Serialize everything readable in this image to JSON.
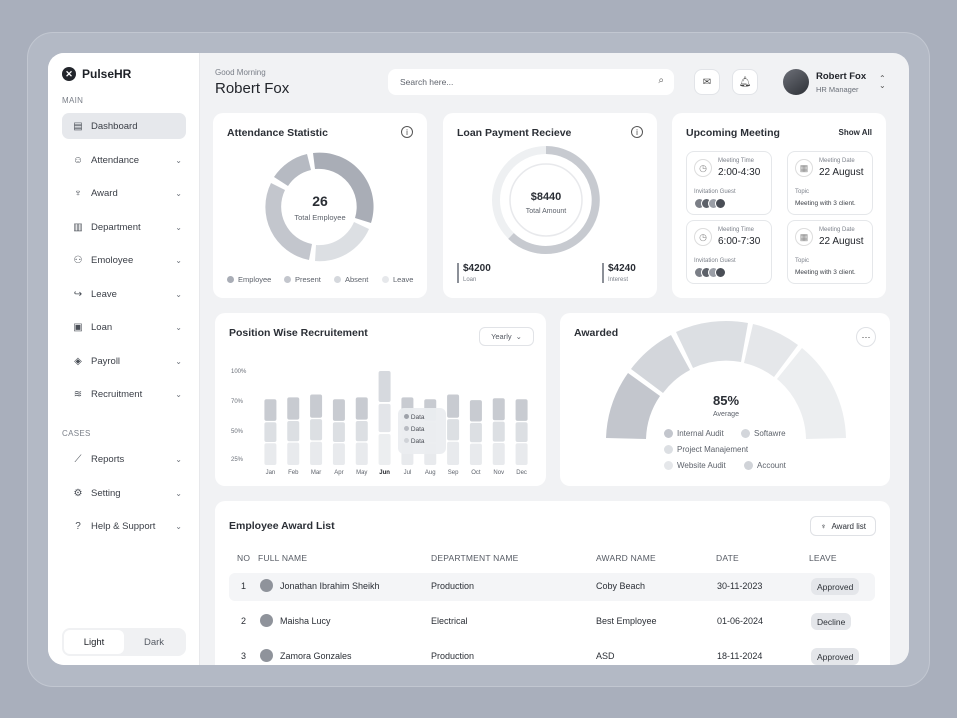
{
  "brand": {
    "name": "PulseHR"
  },
  "sidebar": {
    "main_label": "MAIN",
    "cases_label": "CASES",
    "items": [
      {
        "label": "Dashboard",
        "icon": "dashboard-icon"
      },
      {
        "label": "Attendance",
        "icon": "user-icon"
      },
      {
        "label": "Award",
        "icon": "trophy-icon"
      },
      {
        "label": "Department",
        "icon": "building-icon"
      },
      {
        "label": "Emoloyee",
        "icon": "users-icon"
      },
      {
        "label": "Leave",
        "icon": "exit-icon"
      },
      {
        "label": "Loan",
        "icon": "card-icon"
      },
      {
        "label": "Payroll",
        "icon": "tag-icon"
      },
      {
        "label": "Recruitment",
        "icon": "recruit-icon"
      }
    ],
    "case_items": [
      {
        "label": "Reports",
        "icon": "chart-icon"
      },
      {
        "label": "Setting",
        "icon": "gear-icon"
      },
      {
        "label": "Help & Support",
        "icon": "help-icon"
      }
    ],
    "theme": {
      "light": "Light",
      "dark": "Dark"
    }
  },
  "header": {
    "greeting": "Good Morning",
    "user_name": "Robert Fox",
    "search_placeholder": "Search here...",
    "profile_name": "Robert Fox",
    "profile_role": "HR Manager"
  },
  "attendance": {
    "title": "Attendance Statistic",
    "total": "26",
    "total_label": "Total Employee",
    "legend": [
      "Employee",
      "Present",
      "Absent",
      "Leave"
    ],
    "colors": [
      "#a9adb6",
      "#c3c6cd",
      "#d5d8dd",
      "#e6e8eb"
    ]
  },
  "loan": {
    "title": "Loan Payment Recieve",
    "amount": "$8440",
    "amount_label": "Total Amount",
    "loan_value": "$4200",
    "loan_label": "Loan",
    "interest_value": "$4240",
    "interest_label": "Interest"
  },
  "meeting": {
    "title": "Upcoming Meeting",
    "show_all": "Show All",
    "time_label": "Meeting Time",
    "guest_label": "Invitation Guest",
    "date_label": "Meeting Date",
    "topic_label": "Topic",
    "items": [
      {
        "time": "2:00-4:30",
        "date": "22 August",
        "topic": "Meeting with 3 client."
      },
      {
        "time": "6:00-7:30",
        "date": "22 August",
        "topic": "Meeting with 3 client."
      }
    ]
  },
  "recruitment": {
    "title": "Position Wise Recruitement",
    "filter": "Yearly",
    "tooltip": [
      "Data",
      "Data",
      "Data"
    ]
  },
  "chart_data": {
    "type": "bar",
    "categories": [
      "Jan",
      "Feb",
      "Mar",
      "Apr",
      "May",
      "Jun",
      "Jul",
      "Aug",
      "Sep",
      "Oct",
      "Nov",
      "Dec"
    ],
    "yticks": [
      "100%",
      "70%",
      "50%",
      "25%"
    ],
    "ylim": [
      0,
      100
    ],
    "values": [
      70,
      72,
      75,
      70,
      72,
      100,
      72,
      70,
      75,
      69,
      71,
      70
    ],
    "highlight": "Jun"
  },
  "awarded": {
    "title": "Awarded",
    "percent": "85%",
    "percent_label": "Average",
    "segments": [
      {
        "name": "Internal Audit",
        "color": "#c3c6cd"
      },
      {
        "name": "Softawre",
        "color": "#d3d6db"
      },
      {
        "name": "Project Manajement",
        "color": "#dcdfe3"
      },
      {
        "name": "Website Audit",
        "color": "#e5e7ea"
      },
      {
        "name": "Account",
        "color": "#d0d3d8"
      }
    ]
  },
  "award_list": {
    "title": "Employee Award List",
    "button": "Award list",
    "columns": [
      "NO",
      "FULL NAME",
      "DEPARTMENT NAME",
      "AWARD NAME",
      "DATE",
      "LEAVE"
    ],
    "rows": [
      {
        "no": "1",
        "name": "Jonathan Ibrahim Sheikh",
        "dept": "Production",
        "award": "Coby Beach",
        "date": "30-11-2023",
        "status": "Approved"
      },
      {
        "no": "2",
        "name": "Maisha Lucy",
        "dept": "Electrical",
        "award": "Best Employee",
        "date": "01-06-2024",
        "status": "Decline"
      },
      {
        "no": "3",
        "name": "Zamora Gonzales",
        "dept": "Production",
        "award": "ASD",
        "date": "18-11-2024",
        "status": "Approved"
      }
    ]
  }
}
